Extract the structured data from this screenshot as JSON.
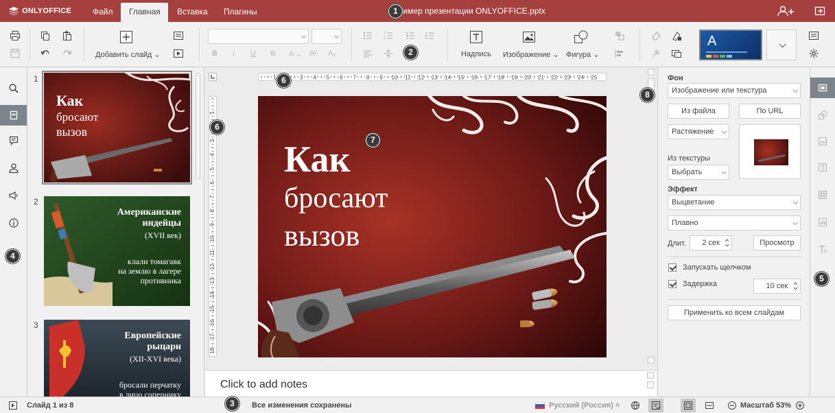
{
  "app": {
    "logo_text": "ONLYOFFICE",
    "title": "Пример презентации ONLYOFFICE.pptx"
  },
  "menu": [
    "Файл",
    "Главная",
    "Вставка",
    "Плагины"
  ],
  "toolbar": {
    "add_slide": "Добавить слайд",
    "textbox": "Надпись",
    "image": "Изображение",
    "shape": "Фигура",
    "theme_letter": "A"
  },
  "slides": [
    {
      "num": "1",
      "line1": "Как",
      "line2": "бросают",
      "line3": "вызов"
    },
    {
      "num": "2",
      "title1": "Американские",
      "title2": "индейцы",
      "title3": "(XVII век)",
      "body1": "клали томагавк",
      "body2": "на землю в лагере",
      "body3": "противника"
    },
    {
      "num": "3",
      "title1": "Европейские",
      "title2": "рыцари",
      "title3": "(XII-XVI века)",
      "body1": "бросали перчатку",
      "body2": "в лицо сопернику"
    }
  ],
  "ruler": {
    "h_ticks": [
      "1",
      "2",
      "3",
      "4",
      "5",
      "6",
      "7",
      "8",
      "9",
      "10",
      "11",
      "12",
      "13",
      "14",
      "15",
      "16",
      "17",
      "18",
      "19",
      "20",
      "21",
      "22",
      "23",
      "24",
      "25"
    ],
    "v_ticks": [
      "1",
      "2",
      "3",
      "4",
      "5",
      "6",
      "7",
      "8",
      "9",
      "10",
      "11",
      "12",
      "13",
      "14",
      "15",
      "16",
      "17",
      "18"
    ]
  },
  "notes_placeholder": "Click to add notes",
  "panel": {
    "bg_label": "Фон",
    "bg_fill": "Изображение или текстура",
    "from_file": "Из файла",
    "by_url": "По URL",
    "stretch": "Растяжение",
    "from_texture": "Из текстуры",
    "choose": "Выбрать",
    "effect_label": "Эффект",
    "effect": "Выцветание",
    "effect_type": "Плавно",
    "duration_label": "Длит.",
    "duration": "2 сек",
    "preview": "Просмотр",
    "start_on_click": "Запускать щелчком",
    "delay_label": "Задержка",
    "delay": "10 сек",
    "apply_all": "Применить ко всем слайдам"
  },
  "status": {
    "slide_of": "Слайд 1 из 8",
    "saved": "Все изменения сохранены",
    "language": "Русский (Россия)",
    "zoom": "Масштаб 53%"
  },
  "callouts": [
    "1",
    "2",
    "3",
    "4",
    "5",
    "6",
    "6",
    "7",
    "8"
  ],
  "colors": {
    "brand": "#a6403e",
    "active_side": "#7d858c"
  }
}
